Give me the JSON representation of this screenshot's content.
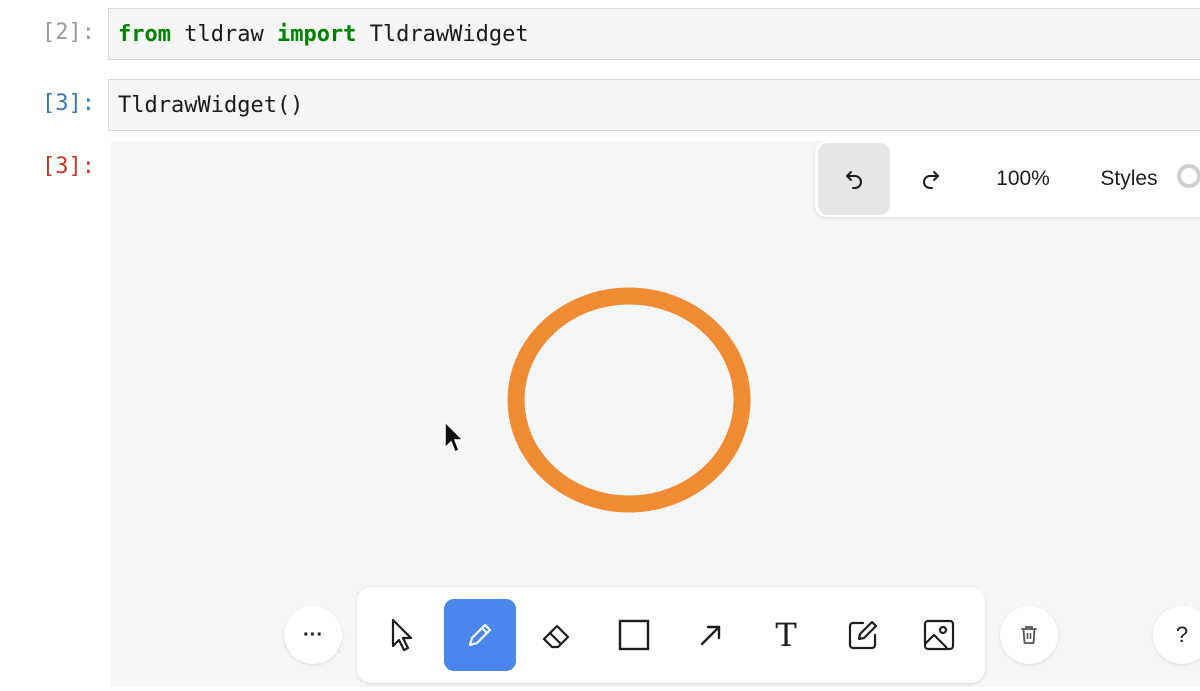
{
  "notebook": {
    "cells": [
      {
        "prompt": "[2]:",
        "prompt_color": "#9b9b9b",
        "code_kw1": "from",
        "code_mid": " tldraw ",
        "code_kw2": "import",
        "code_end": " TldrawWidget"
      },
      {
        "prompt": "[3]:",
        "prompt_color": "#3a78b5",
        "code": "TldrawWidget()"
      }
    ],
    "output_prompt": "[3]:",
    "output_prompt_color": "#c0392b"
  },
  "tldraw": {
    "top_panel": {
      "undo_icon": "undo-icon",
      "redo_icon": "redo-icon",
      "zoom_label": "100%",
      "styles_label": "Styles"
    },
    "shape": {
      "type": "ellipse",
      "color": "#f08a33"
    },
    "toolbar": {
      "more_label": "···",
      "tools": [
        {
          "name": "select-tool",
          "icon": "cursor-icon",
          "active": false
        },
        {
          "name": "draw-tool",
          "icon": "pencil-icon",
          "active": true
        },
        {
          "name": "eraser-tool",
          "icon": "eraser-icon",
          "active": false
        },
        {
          "name": "rectangle-tool",
          "icon": "rectangle-icon",
          "active": false
        },
        {
          "name": "arrow-tool",
          "icon": "arrow-icon",
          "active": false
        },
        {
          "name": "text-tool",
          "icon": "text-icon",
          "active": false
        },
        {
          "name": "note-tool",
          "icon": "note-icon",
          "active": false
        },
        {
          "name": "image-tool",
          "icon": "image-icon",
          "active": false
        }
      ],
      "text_tool_label": "T",
      "delete_icon": "trash-icon",
      "help_label": "?"
    },
    "accent_color": "#4a86ec"
  }
}
